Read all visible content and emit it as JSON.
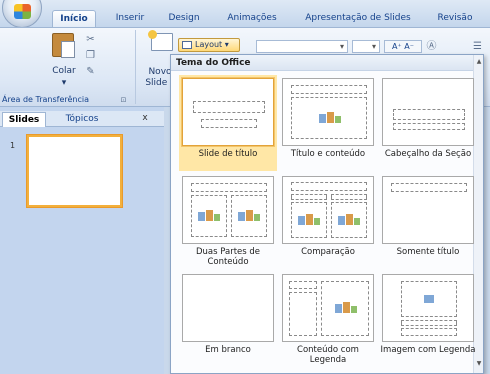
{
  "ribbon_tabs": [
    "Início",
    "Inserir",
    "Design",
    "Animações",
    "Apresentação de Slides",
    "Revisão"
  ],
  "active_tab": "Início",
  "clipboard": {
    "paste_label": "Colar",
    "group_label": "Área de Transferência",
    "dropdown_glyph": "▾",
    "cut_icon": "scissors-icon",
    "copy_icon": "copy-icon",
    "format_painter_icon": "format-painter-icon"
  },
  "slides_group": {
    "new_slide_label": "Novo Slide",
    "new_slide_line1": "Novo",
    "new_slide_line2": "Slide ▾",
    "layout_button": "Layout ▾"
  },
  "font_controls": {
    "font_size_glyph": "A⁺ A⁻",
    "font_box_glyph": "▾"
  },
  "left_pane": {
    "tabs": [
      "Slides",
      "Tópicos"
    ],
    "close_glyph": "x",
    "slide_number": "1"
  },
  "layout_gallery": {
    "header": "Tema do Office",
    "items": [
      {
        "label": "Slide de título",
        "selected": true
      },
      {
        "label": "Título e conteúdo",
        "selected": false
      },
      {
        "label": "Cabeçalho da Seção",
        "selected": false
      },
      {
        "label": "Duas Partes de Conteúdo",
        "selected": false
      },
      {
        "label": "Comparação",
        "selected": false
      },
      {
        "label": "Somente título",
        "selected": false
      },
      {
        "label": "Em branco",
        "selected": false
      },
      {
        "label": "Conteúdo com Legenda",
        "selected": false
      },
      {
        "label": "Imagem com Legenda",
        "selected": false
      }
    ]
  },
  "colors": {
    "accent_selected": "#ffe7a6",
    "ribbon_text": "#15428b"
  }
}
